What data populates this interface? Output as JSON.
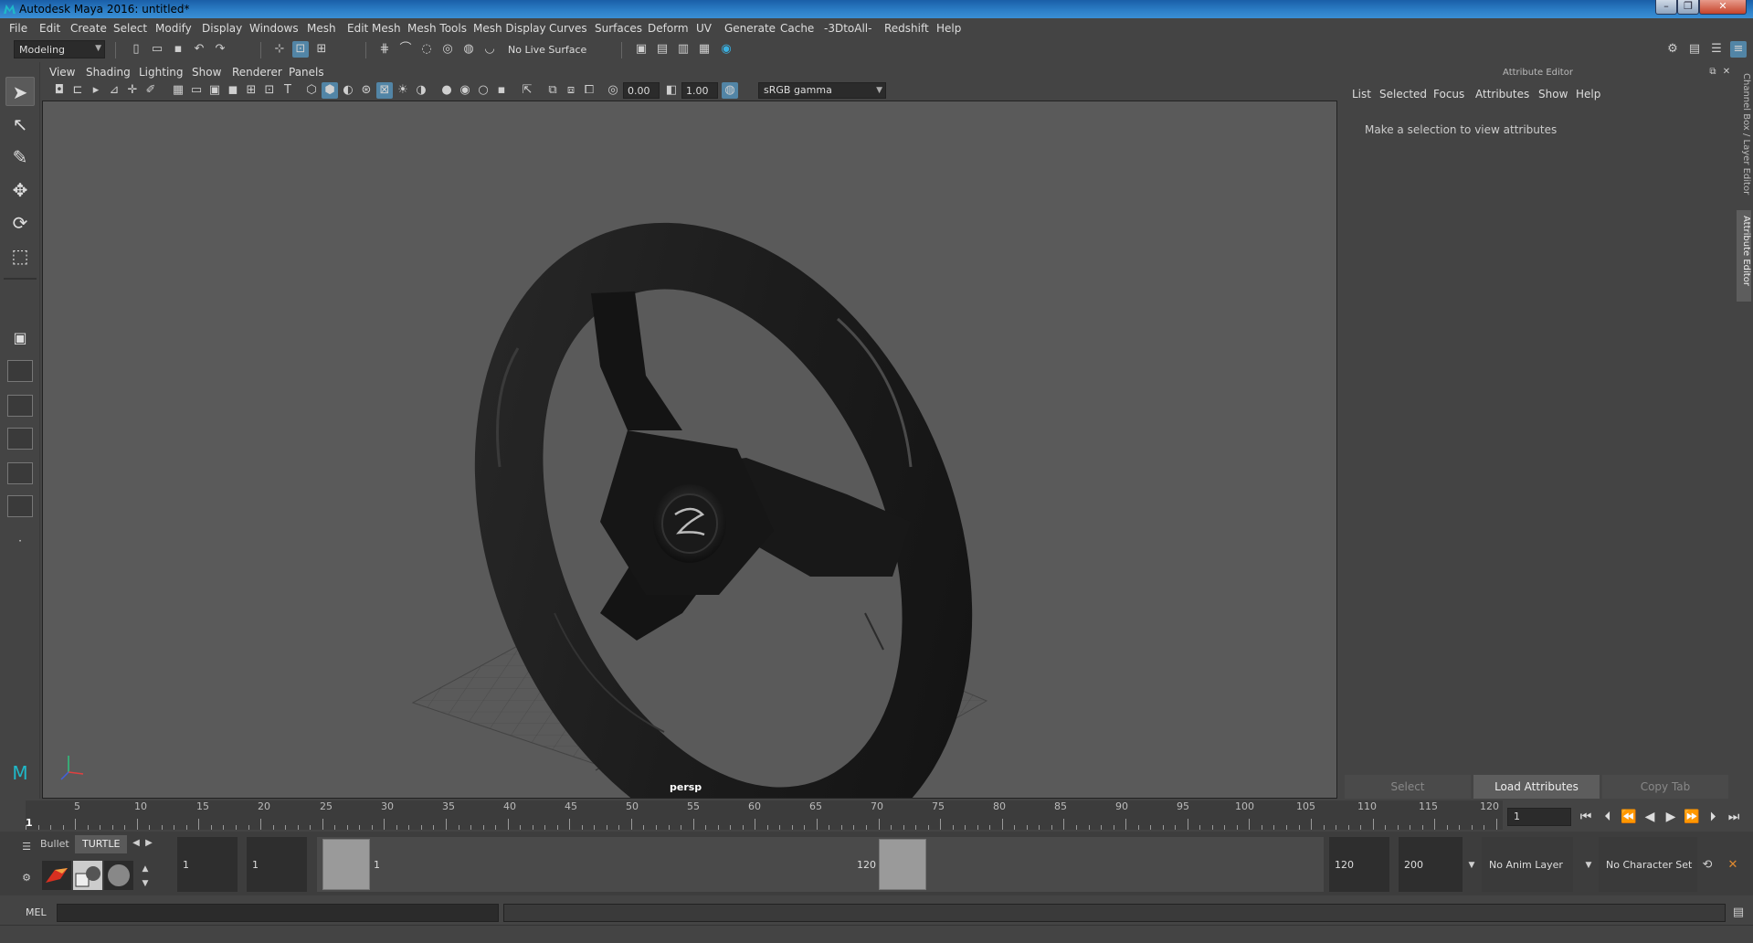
{
  "window": {
    "title": "Autodesk Maya 2016: untitled*"
  },
  "menubar": [
    "File",
    "Edit",
    "Create",
    "Select",
    "Modify",
    "Display",
    "Windows",
    "Mesh",
    "Edit Mesh",
    "Mesh Tools",
    "Mesh Display",
    "Curves",
    "Surfaces",
    "Deform",
    "UV",
    "Generate",
    "Cache",
    "-3DtoAll-",
    "Redshift",
    "Help"
  ],
  "status_line": {
    "mode": "Modeling",
    "live_surface": "No Live Surface"
  },
  "panel_menu": [
    "View",
    "Shading",
    "Lighting",
    "Show",
    "Renderer",
    "Panels"
  ],
  "view_tools": {
    "exposure": "0.00",
    "gamma": "1.00",
    "color_space": "sRGB gamma"
  },
  "viewport": {
    "camera": "persp",
    "object": "steering-wheel"
  },
  "attribute_editor": {
    "title": "Attribute Editor",
    "menu": [
      "List",
      "Selected",
      "Focus",
      "Attributes",
      "Show",
      "Help"
    ],
    "message": "Make a selection to view attributes",
    "buttons": [
      "Select",
      "Load Attributes",
      "Copy Tab"
    ]
  },
  "side_tabs": [
    "Channel Box / Layer Editor",
    "Attribute Editor"
  ],
  "time_slider": {
    "labels": [
      "1",
      "5",
      "10",
      "15",
      "20",
      "25",
      "30",
      "35",
      "40",
      "45",
      "50",
      "55",
      "60",
      "65",
      "70",
      "75",
      "80",
      "85",
      "90",
      "95",
      "100",
      "105",
      "110",
      "115",
      "120"
    ],
    "current_frame": "1"
  },
  "shelf": {
    "tabs": [
      "Bullet",
      "TURTLE"
    ]
  },
  "range": {
    "start": "1",
    "inner_start": "1",
    "range_start_label": "1",
    "range_end_label": "120",
    "inner_end": "120",
    "end": "200",
    "anim_layer": "No Anim Layer",
    "character_set": "No Character Set"
  },
  "command_line": {
    "label": "MEL"
  }
}
